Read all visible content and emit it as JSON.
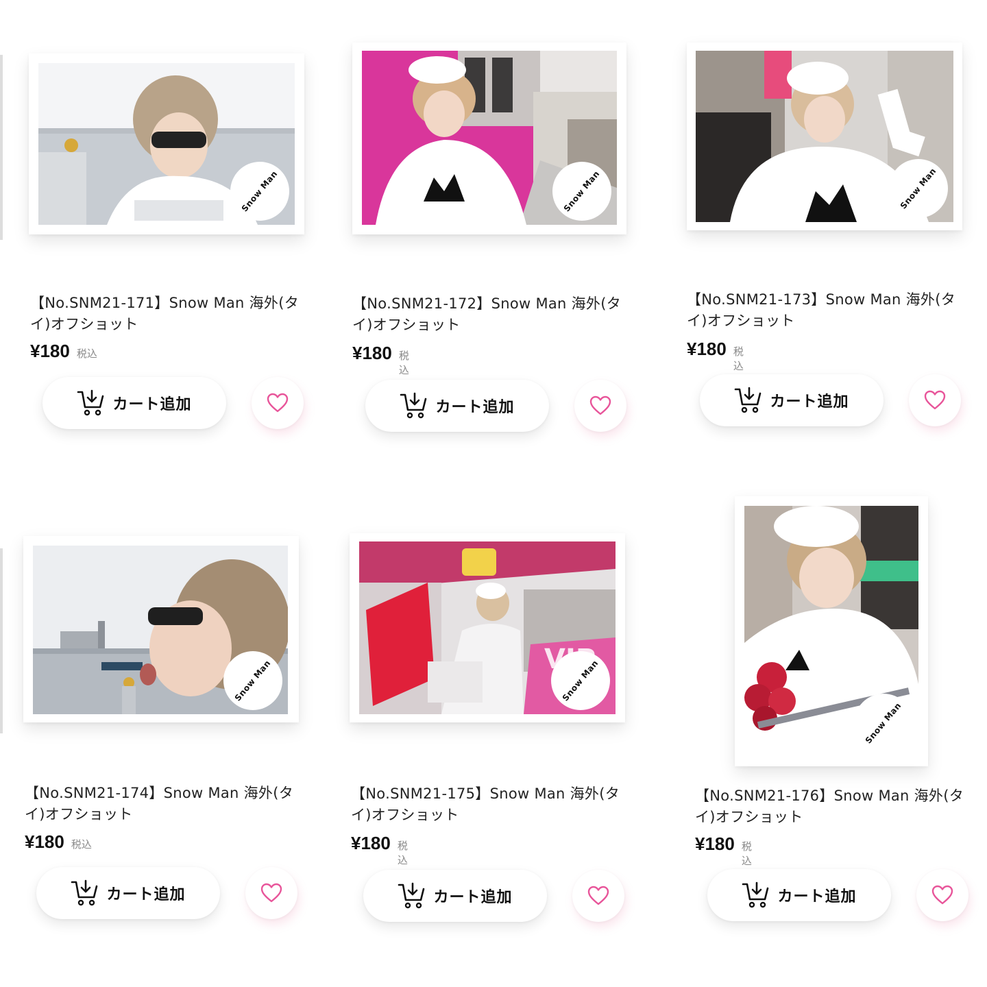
{
  "watermark": "Snow Man",
  "colors": {
    "heart": "#e8559a",
    "background": "#ffffff"
  },
  "products": [
    {
      "title": "【No.SNM21-171】Snow Man 海外(タイ)オフショット",
      "price": "¥180",
      "tax": "税込",
      "cart_label": "カート追加",
      "cart_icon": "cart-download-icon",
      "fav_icon": "heart-outline-icon"
    },
    {
      "title": "【No.SNM21-172】Snow Man 海外(タイ)オフショット",
      "price": "¥180",
      "tax": "税込",
      "cart_label": "カート追加",
      "cart_icon": "cart-download-icon",
      "fav_icon": "heart-outline-icon"
    },
    {
      "title": "【No.SNM21-173】Snow Man 海外(タイ)オフショット",
      "price": "¥180",
      "tax": "税込",
      "cart_label": "カート追加",
      "cart_icon": "cart-download-icon",
      "fav_icon": "heart-outline-icon"
    },
    {
      "title": "【No.SNM21-174】Snow Man 海外(タイ)オフショット",
      "price": "¥180",
      "tax": "税込",
      "cart_label": "カート追加",
      "cart_icon": "cart-download-icon",
      "fav_icon": "heart-outline-icon"
    },
    {
      "title": "【No.SNM21-175】Snow Man 海外(タイ)オフショット",
      "price": "¥180",
      "tax": "税込",
      "cart_label": "カート追加",
      "cart_icon": "cart-download-icon",
      "fav_icon": "heart-outline-icon"
    },
    {
      "title": "【No.SNM21-176】Snow Man 海外(タイ)オフショット",
      "price": "¥180",
      "tax": "税込",
      "cart_label": "カート追加",
      "cart_icon": "cart-download-icon",
      "fav_icon": "heart-outline-icon"
    }
  ]
}
